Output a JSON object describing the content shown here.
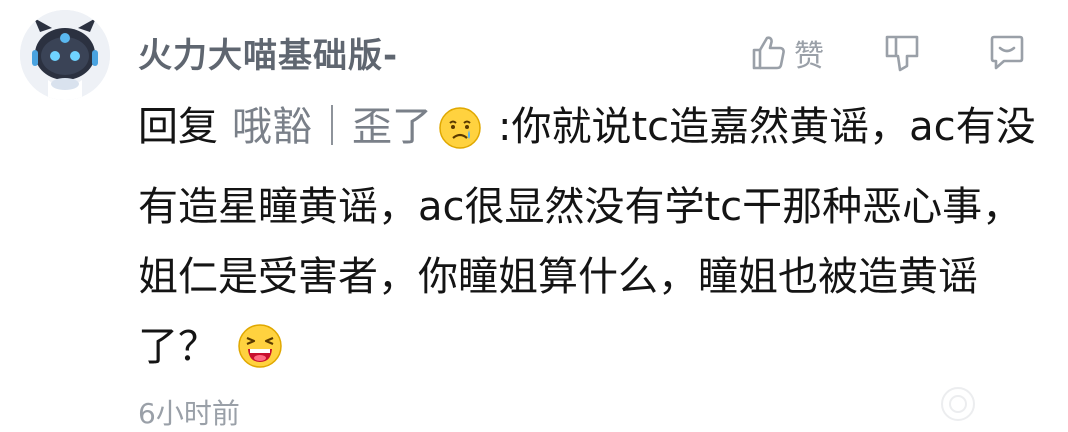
{
  "comment": {
    "username": "火力大喵基础版-",
    "like_label": "赞",
    "reply_prefix": "回复",
    "reply_target": "哦豁｜歪了",
    "text_part1": ":你就说tc造嘉然黄谣，ac有没有造星瞳黄谣，ac很显然没有学tc干那种恶心事，姐仁是受害者，你瞳姐算什么，瞳姐也被造黄谣了？",
    "timestamp": "6小时前"
  },
  "icons": {
    "avatar": "cat-robot-avatar",
    "like": "thumb-up-icon",
    "dislike": "thumb-down-icon",
    "reply": "reply-bubble-icon",
    "emoji_1": "crying-emoji",
    "emoji_2": "laughing-emoji"
  },
  "colors": {
    "username": "#5f6670",
    "body_text": "#141414",
    "reply_target": "#7a8089",
    "muted": "#9aa0a8",
    "background": "#ffffff"
  }
}
